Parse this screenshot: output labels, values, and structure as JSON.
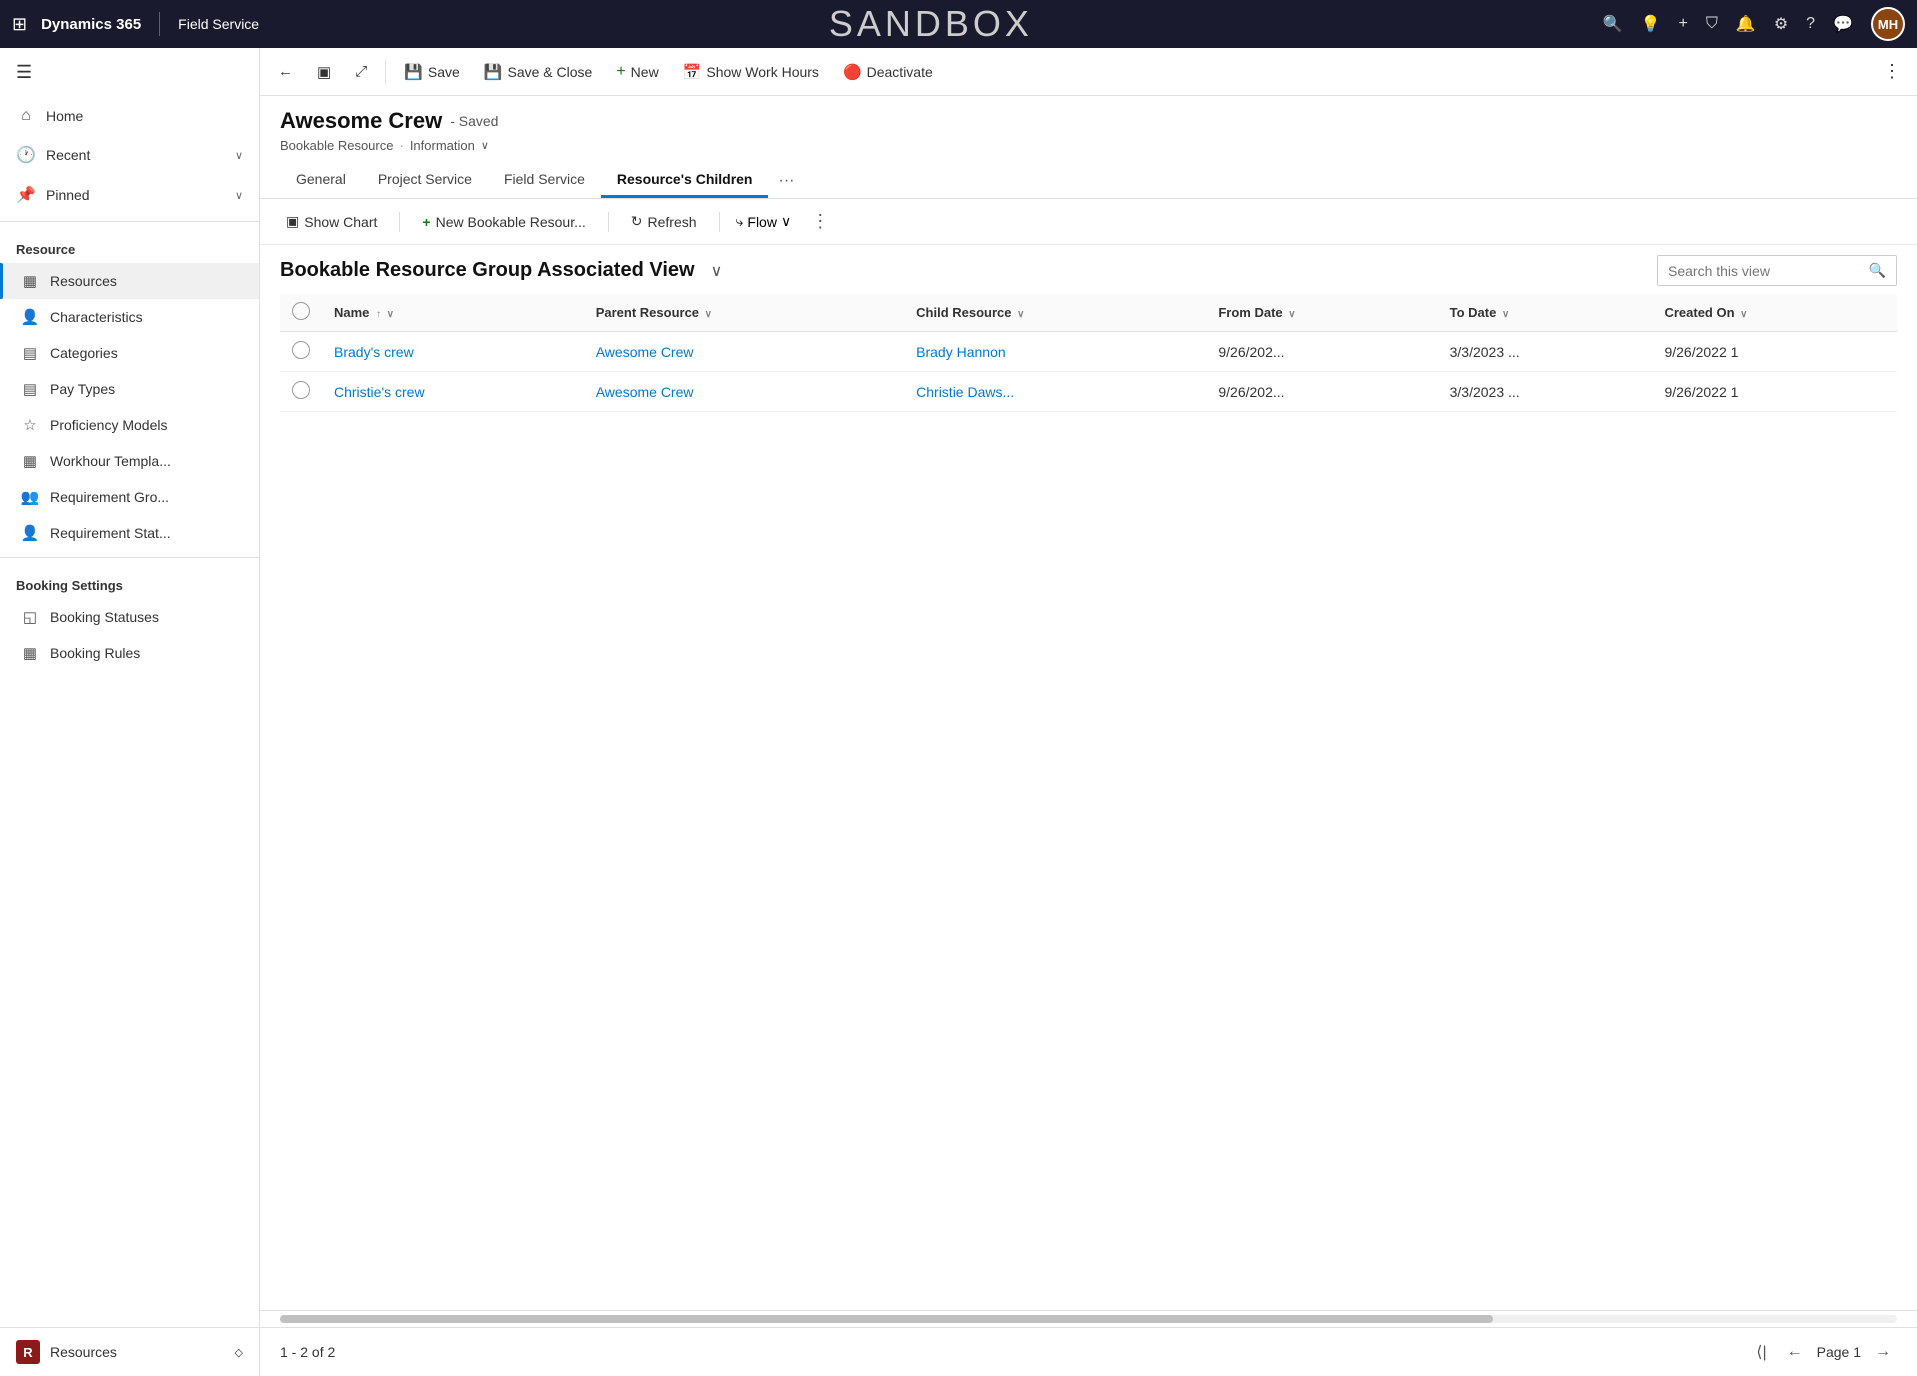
{
  "topNav": {
    "appGrid": "⊞",
    "brand": "Dynamics 365",
    "module": "Field Service",
    "sandboxTitle": "SANDBOX",
    "searchIcon": "🔍",
    "lightbulbIcon": "💡",
    "plusIcon": "+",
    "filterIcon": "⛉",
    "bellIcon": "🔔",
    "gearIcon": "⚙",
    "helpIcon": "?",
    "chatIcon": "💬",
    "avatarInitials": "MH"
  },
  "sidebar": {
    "hamburgerIcon": "☰",
    "navItems": [
      {
        "id": "home",
        "icon": "⌂",
        "label": "Home"
      },
      {
        "id": "recent",
        "icon": "🕐",
        "label": "Recent",
        "hasChevron": true
      },
      {
        "id": "pinned",
        "icon": "📌",
        "label": "Pinned",
        "hasChevron": true
      }
    ],
    "resourceSection": {
      "label": "Resource",
      "items": [
        {
          "id": "resources",
          "icon": "▦",
          "label": "Resources",
          "active": true
        },
        {
          "id": "characteristics",
          "icon": "👤",
          "label": "Characteristics"
        },
        {
          "id": "categories",
          "icon": "▤",
          "label": "Categories"
        },
        {
          "id": "pay-types",
          "icon": "▤",
          "label": "Pay Types"
        },
        {
          "id": "proficiency-models",
          "icon": "☆",
          "label": "Proficiency Models"
        },
        {
          "id": "workhour-templates",
          "icon": "▦",
          "label": "Workhour Templa..."
        },
        {
          "id": "requirement-groups",
          "icon": "👥",
          "label": "Requirement Gro..."
        },
        {
          "id": "requirement-statuses",
          "icon": "👤",
          "label": "Requirement Stat..."
        }
      ]
    },
    "bookingSection": {
      "label": "Booking Settings",
      "items": [
        {
          "id": "booking-statuses",
          "icon": "◱",
          "label": "Booking Statuses"
        },
        {
          "id": "booking-rules",
          "icon": "▦",
          "label": "Booking Rules"
        }
      ]
    },
    "bottomItem": {
      "badge": "R",
      "label": "Resources",
      "chevron": "◇"
    }
  },
  "toolbar": {
    "backIcon": "←",
    "pageIcon": "▣",
    "popoutIcon": "⤢",
    "saveLabel": "Save",
    "saveCloseLabel": "Save & Close",
    "newLabel": "New",
    "showWorkHoursLabel": "Show Work Hours",
    "deactivateLabel": "Deactivate",
    "moreIcon": "⋮"
  },
  "record": {
    "title": "Awesome Crew",
    "savedStatus": "- Saved",
    "entityType": "Bookable Resource",
    "view": "Information",
    "tabs": [
      {
        "id": "general",
        "label": "General",
        "active": false
      },
      {
        "id": "project-service",
        "label": "Project Service",
        "active": false
      },
      {
        "id": "field-service",
        "label": "Field Service",
        "active": false
      },
      {
        "id": "resources-children",
        "label": "Resource's Children",
        "active": true
      }
    ],
    "tabMore": "···"
  },
  "subgridToolbar": {
    "showChartIcon": "▣",
    "showChartLabel": "Show Chart",
    "newIcon": "+",
    "newLabel": "New Bookable Resour...",
    "refreshIcon": "↻",
    "refreshLabel": "Refresh",
    "flowIcon": "⤷",
    "flowLabel": "Flow",
    "flowChevron": "∨",
    "moreIcon": "⋮"
  },
  "grid": {
    "viewTitle": "Bookable Resource Group Associated View",
    "viewChevron": "∨",
    "searchPlaceholder": "Search this view",
    "searchIcon": "🔍",
    "columns": [
      {
        "id": "name",
        "label": "Name",
        "sortIcon": "↑↓",
        "hasChevron": true
      },
      {
        "id": "parent-resource",
        "label": "Parent Resource",
        "hasChevron": true
      },
      {
        "id": "child-resource",
        "label": "Child Resource",
        "hasChevron": true
      },
      {
        "id": "from-date",
        "label": "From Date",
        "hasChevron": true
      },
      {
        "id": "to-date",
        "label": "To Date",
        "hasChevron": true
      },
      {
        "id": "created-on",
        "label": "Created On",
        "hasChevron": true
      }
    ],
    "rows": [
      {
        "id": "row1",
        "name": "Brady's crew",
        "parentResource": "Awesome Crew",
        "childResource": "Brady Hannon",
        "fromDate": "9/26/202...",
        "toDate": "3/3/2023 ...",
        "createdOn": "9/26/2022 1"
      },
      {
        "id": "row2",
        "name": "Christie's crew",
        "parentResource": "Awesome Crew",
        "childResource": "Christie Daws...",
        "fromDate": "9/26/202...",
        "toDate": "3/3/2023 ...",
        "createdOn": "9/26/2022 1"
      }
    ]
  },
  "pagination": {
    "info": "1 - 2 of 2",
    "firstIcon": "⟨|",
    "prevIcon": "←",
    "pageLabel": "Page 1",
    "nextIcon": "→"
  }
}
